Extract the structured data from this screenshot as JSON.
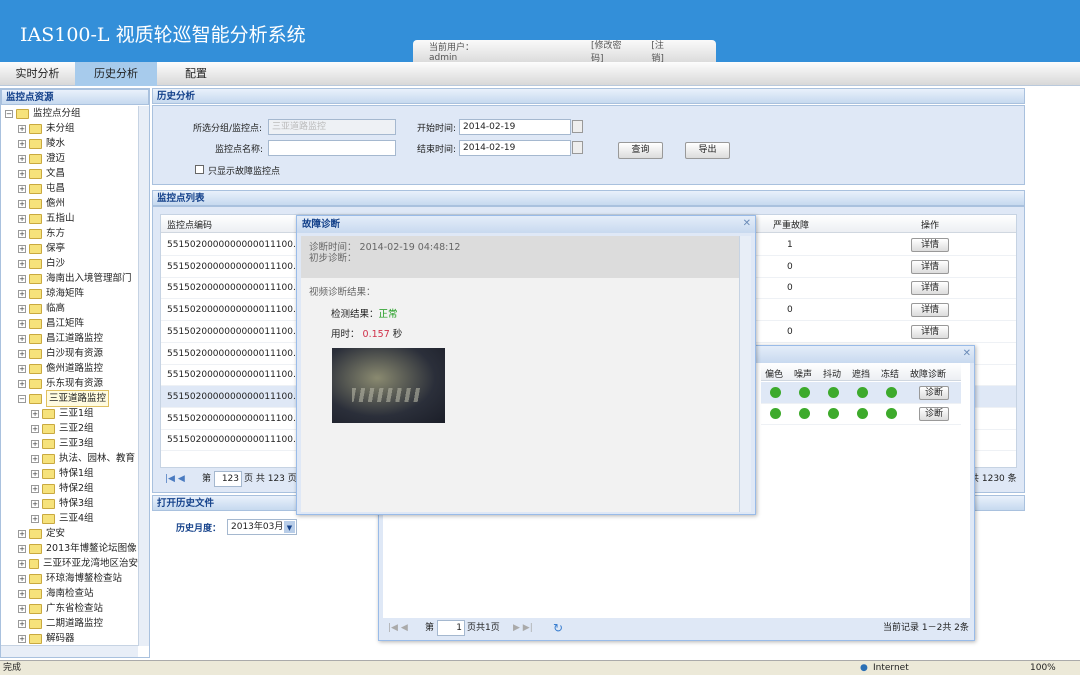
{
  "app": {
    "title": "IAS100-L  视质轮巡智能分析系统",
    "user": "当前用户：admin",
    "change_password": "[修改密码]",
    "logout": "[注销]"
  },
  "nav": {
    "tabs": [
      {
        "label": "实时分析"
      },
      {
        "label": "历史分析",
        "active": true
      },
      {
        "label": "配置"
      }
    ]
  },
  "sidebar": {
    "title": "监控点资源",
    "root": "监控点分组",
    "items": [
      "未分组",
      "陵水",
      "澄迈",
      "文昌",
      "屯昌",
      "儋州",
      "五指山",
      "东方",
      "保亭",
      "白沙",
      "海南出入境管理部门",
      "琼海矩阵",
      "临高",
      "昌江矩阵",
      "昌江道路监控",
      "白沙现有资源",
      "儋州道路监控",
      "乐东现有资源"
    ],
    "expanded": "三亚道路监控",
    "children": [
      "三亚1组",
      "三亚2组",
      "三亚3组",
      "执法、园林、教育",
      "特保1组",
      "特保2组",
      "特保3组",
      "三亚4组"
    ],
    "items_after": [
      "定安",
      "2013年博鳌论坛图像",
      "三亚环亚龙湾地区治安",
      "环琼海博鳌检查站",
      "海南检查站",
      "广东省检查站",
      "二期道路监控",
      "解码器"
    ]
  },
  "history": {
    "title": "历史分析",
    "group_label": "所选分组/监控点:",
    "group_value": "三亚道路监控",
    "name_label": "监控点名称:",
    "name_value": "",
    "start_label": "开始时间:",
    "start_value": "2014-02-19",
    "end_label": "结束时间:",
    "end_value": "2014-02-19",
    "fault_only_label": "只显示故障监控点",
    "query": "查询",
    "export": "导出"
  },
  "list": {
    "title": "监控点列表",
    "columns": [
      "监控点编码",
      "严重故障",
      "操作"
    ],
    "rows": [
      {
        "code": "5515020000000000011100...",
        "severe": "1"
      },
      {
        "code": "5515020000000000011100...",
        "severe": "0"
      },
      {
        "code": "5515020000000000011100...",
        "severe": "0"
      },
      {
        "code": "5515020000000000011100...",
        "severe": "0"
      },
      {
        "code": "5515020000000000011100...",
        "severe": "0"
      },
      {
        "code": "5515020000000000011100...",
        "severe": ""
      },
      {
        "code": "5515020000000000011100...",
        "severe": ""
      },
      {
        "code": "5515020000000000011100...",
        "severe": ""
      },
      {
        "code": "5515020000000000011100...",
        "severe": ""
      },
      {
        "code": "5515020000000000011100...",
        "severe": ""
      }
    ],
    "detail_label": "详情",
    "page_prefix": "第",
    "page_value": "123",
    "page_suffix": "页 共 123 页",
    "total": "共 1230 条"
  },
  "history_file": {
    "title": "打开历史文件",
    "month_label": "历史月度：",
    "month_value": "2013年03月"
  },
  "diag_dialog": {
    "title": "故障诊断",
    "time_label": "诊断时间：",
    "time_value": "2014-02-19 04:48:12",
    "initial_label": "初步诊断：",
    "result_title": "视频诊断结果：",
    "detect_label": "检测结果：",
    "detect_value": "正常",
    "elapsed_label": "用时：",
    "elapsed_value": "0.157",
    "elapsed_unit": "秒",
    "colors": {
      "normal": "#1a9a1a",
      "time": "#d0304a"
    }
  },
  "detail_dialog": {
    "columns": [
      "偏色",
      "噪声",
      "抖动",
      "遮挡",
      "冻结",
      "故障诊断"
    ],
    "rows": [
      {
        "status": [
          "ok",
          "ok",
          "ok",
          "ok",
          "ok"
        ]
      },
      {
        "status": [
          "ok",
          "ok",
          "ok",
          "ok",
          "ok"
        ]
      }
    ],
    "diag_label": "诊断",
    "page_prefix": "第",
    "page_value": "1",
    "page_suffix": "页共1页",
    "records": "当前记录 1－2共 2条"
  },
  "statusbar": {
    "text": "完成",
    "zone": "Internet",
    "zoom": "100%"
  }
}
